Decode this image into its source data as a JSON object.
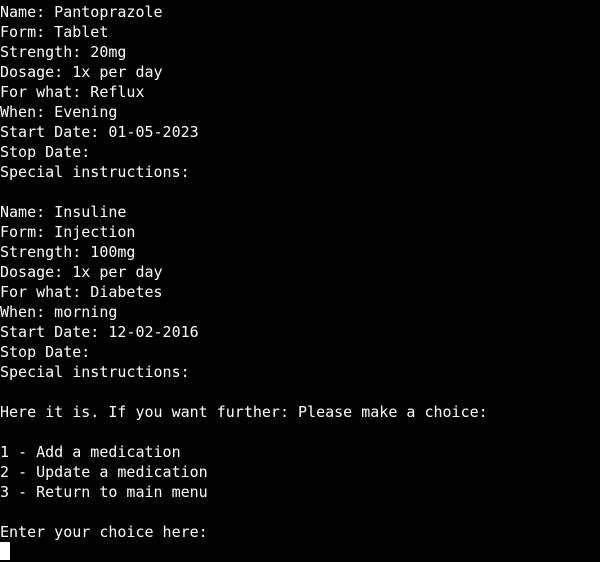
{
  "terminal": {
    "background_color": "#000000",
    "foreground_color": "#ffffff",
    "cursor": {
      "visible": true,
      "color": "#ffffff",
      "column": 0,
      "row": 27
    }
  },
  "medications": [
    {
      "name_label": "Name: Pantoprazole",
      "form_label": "Form: Tablet",
      "strength_label": "Strength: 20mg",
      "dosage_label": "Dosage: 1x per day",
      "for_what_label": "For what: Reflux",
      "when_label": "When: Evening",
      "start_date_label": "Start Date: 01-05-2023",
      "stop_date_label": "Stop Date:",
      "special_instructions_label": "Special instructions:"
    },
    {
      "name_label": "Name: Insuline",
      "form_label": "Form: Injection",
      "strength_label": "Strength: 100mg",
      "dosage_label": "Dosage: 1x per day",
      "for_what_label": "For what: Diabetes",
      "when_label": "When: morning",
      "start_date_label": "Start Date: 12-02-2016",
      "stop_date_label": "Stop Date:",
      "special_instructions_label": "Special instructions:"
    }
  ],
  "prompt": {
    "message": "Here it is. If you want further: Please make a choice:",
    "menu_options": [
      "1 - Add a medication",
      "2 - Update a medication",
      "3 - Return to main menu"
    ],
    "input_prompt": "Enter your choice here:",
    "input_value": ""
  }
}
